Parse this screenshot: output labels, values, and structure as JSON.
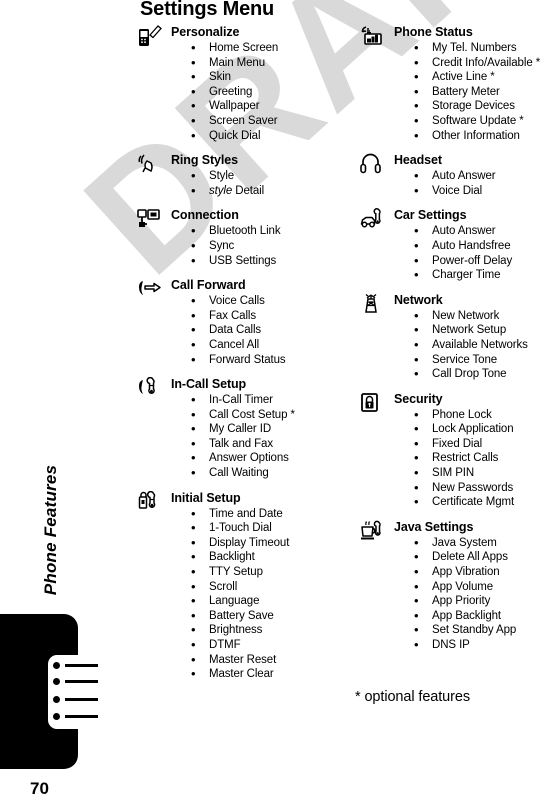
{
  "page": {
    "title": "Settings Menu",
    "number": "70",
    "side_label": "Phone Features",
    "watermark": "DRAFT",
    "footnote": "* optional features"
  },
  "columns": {
    "left": [
      {
        "icon": "phone-pencil-icon",
        "title": "Personalize",
        "items": [
          "Home Screen",
          "Main Menu",
          "Skin",
          "Greeting",
          "Wallpaper",
          "Screen Saver",
          "Quick Dial"
        ]
      },
      {
        "icon": "ring-styles-icon",
        "title": "Ring Styles",
        "items": [
          "Style",
          {
            "italic": "style",
            "rest": " Detail"
          }
        ]
      },
      {
        "icon": "connection-icon",
        "title": "Connection",
        "items": [
          "Bluetooth Link",
          "Sync",
          "USB Settings"
        ]
      },
      {
        "icon": "call-forward-icon",
        "title": "Call Forward",
        "items": [
          "Voice Calls",
          "Fax Calls",
          "Data Calls",
          "Cancel All",
          "Forward Status"
        ]
      },
      {
        "icon": "in-call-setup-icon",
        "title": "In-Call Setup",
        "items": [
          "In-Call Timer",
          "Call Cost Setup *",
          "My Caller ID",
          "Talk and Fax",
          "Answer Options",
          "Call Waiting"
        ]
      },
      {
        "icon": "initial-setup-icon",
        "title": "Initial Setup",
        "items": [
          "Time and Date",
          "1-Touch Dial",
          "Display Timeout",
          "Backlight",
          "TTY Setup",
          "Scroll",
          "Language",
          "Battery Save",
          "Brightness",
          "DTMF",
          "Master Reset",
          "Master Clear"
        ]
      }
    ],
    "right": [
      {
        "icon": "phone-status-icon",
        "title": "Phone Status",
        "items": [
          "My Tel. Numbers",
          "Credit Info/Available *",
          "Active Line *",
          "Battery Meter",
          "Storage Devices",
          "Software Update *",
          "Other Information"
        ]
      },
      {
        "icon": "headset-icon",
        "title": "Headset",
        "items": [
          "Auto Answer",
          "Voice Dial"
        ]
      },
      {
        "icon": "car-settings-icon",
        "title": "Car Settings",
        "items": [
          "Auto Answer",
          "Auto Handsfree",
          "Power-off Delay",
          "Charger Time"
        ]
      },
      {
        "icon": "network-antenna-icon",
        "title": "Network",
        "items": [
          "New Network",
          "Network Setup",
          "Available Networks",
          "Service Tone",
          "Call Drop Tone"
        ]
      },
      {
        "icon": "security-lock-icon",
        "title": "Security",
        "items": [
          "Phone Lock",
          "Lock Application",
          "Fixed Dial",
          "Restrict Calls",
          "SIM PIN",
          "New Passwords",
          "Certificate Mgmt"
        ]
      },
      {
        "icon": "java-settings-icon",
        "title": "Java Settings",
        "items": [
          "Java System",
          "Delete All Apps",
          "App Vibration",
          "App Volume",
          "App Priority",
          "App Backlight",
          "Set Standby App",
          "DNS IP"
        ]
      }
    ]
  },
  "colors": {
    "ink": "#000000",
    "paper": "#ffffff",
    "watermark": "#d9d9d9"
  }
}
